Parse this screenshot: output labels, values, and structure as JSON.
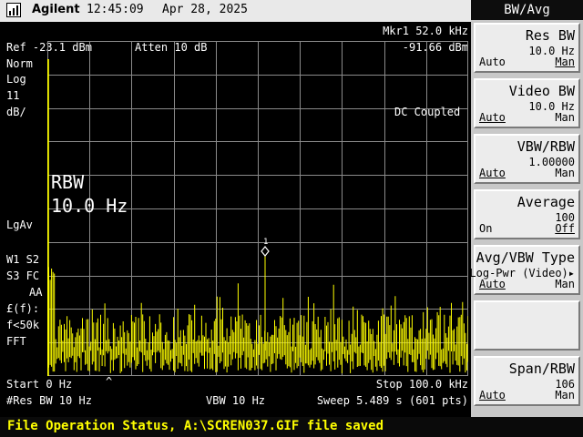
{
  "header": {
    "brand": "Agilent",
    "time": "12:45:09",
    "date": "Apr 28, 2025",
    "status_icon": "signal-meter-icon"
  },
  "marker": {
    "line1": "Mkr1  52.0 kHz",
    "line2": "-91.66 dBm",
    "label": "1"
  },
  "ref_line": {
    "ref": "Ref -23.1 dBm",
    "atten": "Atten 10 dB"
  },
  "left_labels": {
    "norm": "Norm",
    "log": "Log",
    "scale": "11",
    "unit": "dB/",
    "lgav": "LgAv",
    "w1s2": "W1  S2",
    "s3fc": "S3  FC",
    "aa": "AA",
    "ff": "£(f):",
    "fk": "f<50k",
    "fft": "FFT"
  },
  "coupling": "DC Coupled",
  "rbw_overlay": {
    "label": "RBW",
    "value": "10.0  Hz"
  },
  "bottom": {
    "start": "Start 0 Hz",
    "stop": "Stop 100.0 kHz",
    "res_bw": "#Res BW 10 Hz",
    "vbw": "VBW 10 Hz",
    "sweep": "Sweep 5.489 s (601 pts)"
  },
  "menu": {
    "title": "BW/Avg",
    "keys": [
      {
        "title": "Res BW",
        "value": "10.0  Hz",
        "left": "Auto",
        "right": "Man"
      },
      {
        "title": "Video BW",
        "value": "10.0  Hz",
        "left": "Auto",
        "right": "Man"
      },
      {
        "title": "VBW/RBW",
        "value": "1.00000",
        "left": "Auto",
        "right": "Man"
      },
      {
        "title": "Average",
        "value": "100",
        "left": "On",
        "right": "Off"
      },
      {
        "title": "Avg/VBW Type",
        "value": "Log-Pwr (Video)▸",
        "left": "Auto",
        "right": "Man"
      },
      {
        "title": "",
        "value": "",
        "left": "",
        "right": ""
      },
      {
        "title": "Span/RBW",
        "value": "106",
        "left": "Auto",
        "right": "Man"
      }
    ]
  },
  "status_bar": "File Operation Status, A:\\SCREN037.GIF file saved",
  "colors": {
    "trace": "#ffff00",
    "grid": "#8a8a8a",
    "background": "#000000",
    "status_text": "#ffff00"
  }
}
